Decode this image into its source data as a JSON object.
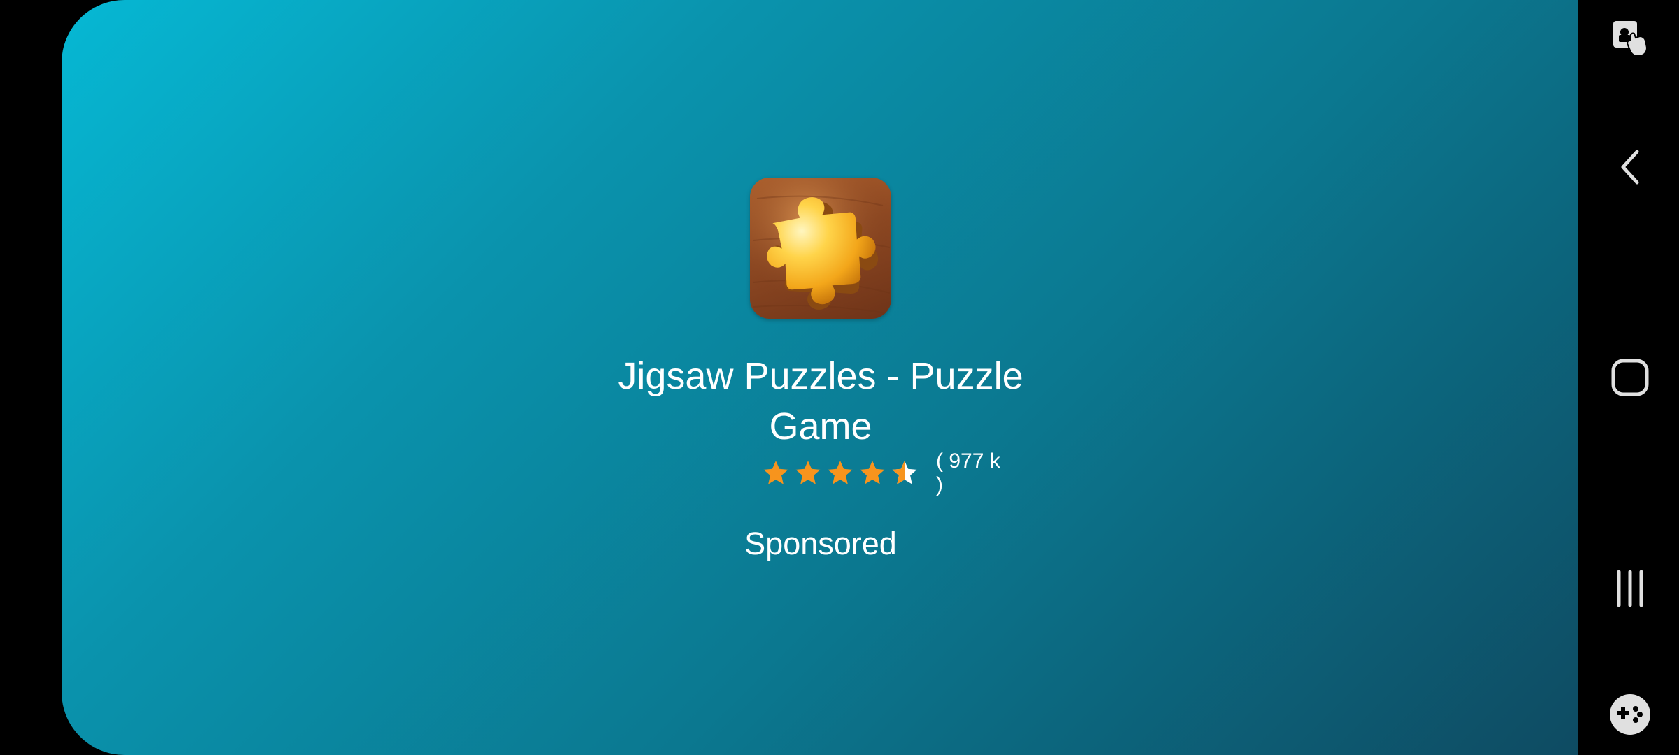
{
  "ad": {
    "app_icon": "jigsaw-puzzle-piece-icon",
    "title": "Jigsaw Puzzles - Puzzle Game",
    "rating": 4.5,
    "rating_max": 5,
    "rating_count": "( 977 k )",
    "sponsored_label": "Sponsored"
  },
  "nav_bar": {
    "buttons": [
      {
        "icon": "touch-lock-icon"
      },
      {
        "icon": "back-icon"
      },
      {
        "icon": "home-icon"
      },
      {
        "icon": "recent-apps-icon"
      },
      {
        "icon": "game-booster-icon"
      }
    ]
  },
  "colors": {
    "gradient_start": "#06b8d4",
    "gradient_end": "#0e4b62",
    "star": "#f7941d",
    "star_empty": "#ffffff",
    "text": "#ffffff",
    "nav_icon": "#e0e0e0"
  }
}
